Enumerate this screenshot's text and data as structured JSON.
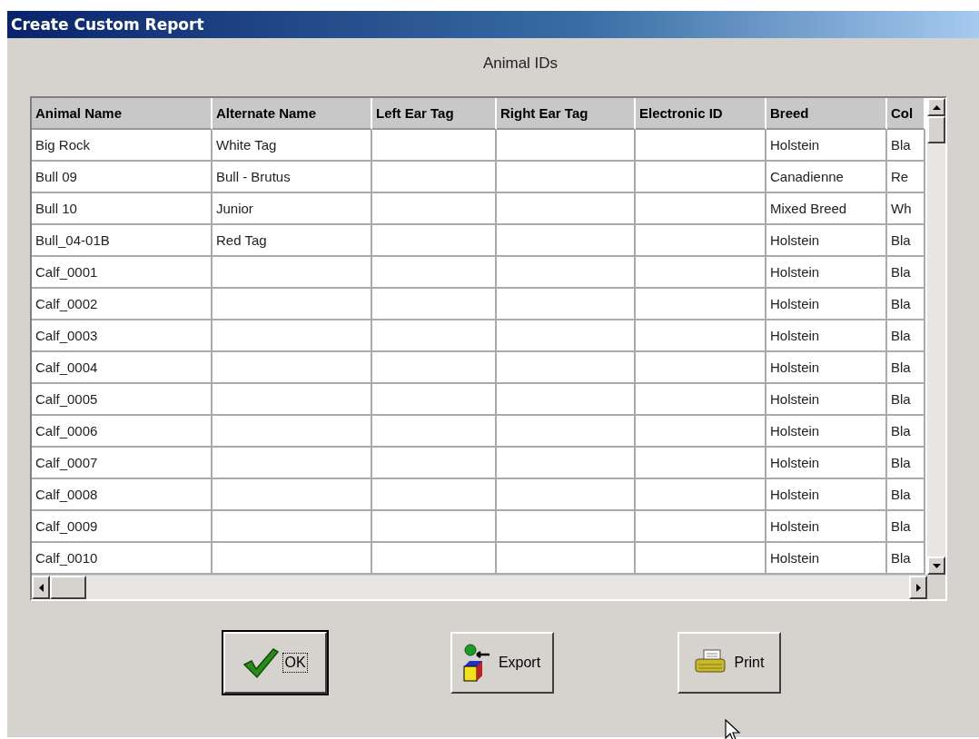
{
  "window": {
    "title": "Create Custom Report"
  },
  "caption": "Animal IDs",
  "table": {
    "columns": [
      "Animal Name",
      "Alternate Name",
      "Left Ear Tag",
      "Right Ear Tag",
      "Electronic ID",
      "Breed",
      "Col"
    ],
    "rows": [
      [
        "Big Rock",
        "White Tag",
        "",
        "",
        "",
        "Holstein",
        "Bla"
      ],
      [
        "Bull 09",
        "Bull - Brutus",
        "",
        "",
        "",
        "Canadienne",
        "Re"
      ],
      [
        "Bull 10",
        "Junior",
        "",
        "",
        "",
        "Mixed Breed",
        "Wh"
      ],
      [
        "Bull_04-01B",
        "Red Tag",
        "",
        "",
        "",
        "Holstein",
        "Bla"
      ],
      [
        "Calf_0001",
        "",
        "",
        "",
        "",
        "Holstein",
        "Bla"
      ],
      [
        "Calf_0002",
        "",
        "",
        "",
        "",
        "Holstein",
        "Bla"
      ],
      [
        "Calf_0003",
        "",
        "",
        "",
        "",
        "Holstein",
        "Bla"
      ],
      [
        "Calf_0004",
        "",
        "",
        "",
        "",
        "Holstein",
        "Bla"
      ],
      [
        "Calf_0005",
        "",
        "",
        "",
        "",
        "Holstein",
        "Bla"
      ],
      [
        "Calf_0006",
        "",
        "",
        "",
        "",
        "Holstein",
        "Bla"
      ],
      [
        "Calf_0007",
        "",
        "",
        "",
        "",
        "Holstein",
        "Bla"
      ],
      [
        "Calf_0008",
        "",
        "",
        "",
        "",
        "Holstein",
        "Bla"
      ],
      [
        "Calf_0009",
        "",
        "",
        "",
        "",
        "Holstein",
        "Bla"
      ],
      [
        "Calf_0010",
        "",
        "",
        "",
        "",
        "Holstein",
        "Bla"
      ]
    ]
  },
  "buttons": [
    {
      "label": "OK",
      "kind": "ok",
      "focused": true
    },
    {
      "label": "Export",
      "kind": "export",
      "focused": false
    },
    {
      "label": "Print",
      "kind": "print",
      "focused": false
    }
  ]
}
